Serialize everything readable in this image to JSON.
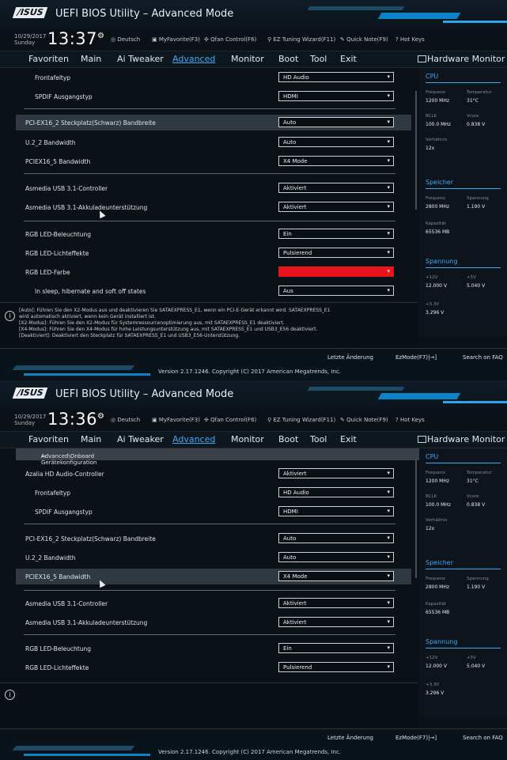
{
  "app_title": "UEFI BIOS Utility – Advanced Mode",
  "logo_text": "/ISUS",
  "accent_color": "#3fa9f5",
  "icons": [
    "logo",
    "info-icon",
    "hw-monitor-icon",
    "back-arrow-icon",
    "dropdown-arrow-icon",
    "cursor-icon"
  ],
  "menu": [
    "Favoriten",
    "Main",
    "Ai Tweaker",
    "Advanced",
    "Monitor",
    "Boot",
    "Tool",
    "Exit"
  ],
  "menu_active": "Advanced",
  "hw_monitor_title": "Hardware Monitor",
  "infobar": {
    "date": "10/29/2017",
    "day": "Sunday",
    "items": [
      "Deutsch",
      "MyFavorite(F3)",
      "Qfan Control(F6)",
      "EZ Tuning Wizard(F11)",
      "Quick Note(F9)",
      "Hot Keys"
    ]
  },
  "bottom": {
    "last_change": "Letzte Änderung",
    "ezmode": "EzMode(F7)|→]",
    "search": "Search on FAQ",
    "copyright": "Version 2.17.1246. Copyright (C) 2017 American Megatrends, Inc."
  },
  "hw": {
    "cpu_title": "CPU",
    "freq_label": "Frequenz",
    "freq_value": "1200 MHz",
    "temp_label": "Temperatur",
    "temp_value": "31°C",
    "bclk_label": "BCLK",
    "bclk_value": "100.0 MHz",
    "core_label": "Vcore",
    "core_value": "0.838 V",
    "ratio_label": "Verhältnis",
    "ratio_value": "12x",
    "mem_title": "Speicher",
    "mfreq_label": "Frequenz",
    "mfreq_value": "2800 MHz",
    "volt_label": "Spannung",
    "volt_value": "1.190 V",
    "cap_label": "Kapazität",
    "cap_value": "65536 MB",
    "volt_title": "Spannung",
    "v12_label": "+12V",
    "v12_value": "12.000 V",
    "v5_label": "+5V",
    "v5_value": "5.040 V",
    "v33_label": "+3.3V",
    "v33_value": "3.296 V"
  },
  "panel1": {
    "time": "13:37",
    "rows": [
      {
        "label": "Frontafeltyp",
        "value": "HD Audio"
      },
      {
        "label": "SPDIF Ausgangstyp",
        "value": "HDMI"
      },
      {
        "label": "PCI-EX16_2 Steckplatz(Schwarz) Bandbreite",
        "value": "Auto"
      },
      {
        "label": "U.2_2 Bandwidth",
        "value": "Auto"
      },
      {
        "label": "PCIEX16_5 Bandwidth",
        "value": "X4 Mode"
      },
      {
        "label": "Asmedia USB 3.1-Controller",
        "value": "Aktiviert"
      },
      {
        "label": "Asmedia USB 3.1-Akkuladeunterstützung",
        "value": "Aktiviert"
      },
      {
        "label": "RGB LED-Beleuchtung",
        "value": "Ein"
      },
      {
        "label": "RGB LED-Lichteffekte",
        "value": "Pulsierend"
      },
      {
        "label": "RGB LED-Farbe",
        "value": ""
      },
      {
        "label": "In sleep, hibernate and soft off states",
        "value": "Aus"
      }
    ],
    "help": [
      "[Auto]: Führen Sie den X2-Modus aus und deaktivieren Sie SATAEXPRESS_E1, wenn ein PCI-E-Gerät erkannt wird. SATAEXPRESS_E1",
      "wird automatisch aktiviert, wenn kein Gerät installiert ist.",
      "[X2-Modus]: Führen Sie den X2-Modus für Systemressourcenoptimierung aus, mit SATAEXPRESS_E1 deaktiviert.",
      "[X4-Modus]: Führen Sie den X4-Modus für hohe Leistungsunterstützung aus, mit SATAEXPRESS_E1 und USB3_E56 deaktiviert.",
      "[Deaktiviert]: Deaktiviert den Steckplatz für SATAEXPRESS_E1 und USB3_E56-Unterstützung."
    ]
  },
  "panel2": {
    "time": "13:36",
    "breadcrumb": "Advanced\\Onboard Gerätekonfiguration",
    "rows": [
      {
        "label": "Azalia HD Audio-Controller",
        "value": "Aktiviert"
      },
      {
        "label": "Frontafeltyp",
        "value": "HD Audio"
      },
      {
        "label": "SPDIF Ausgangstyp",
        "value": "HDMI"
      },
      {
        "label": "PCI-EX16_2 Steckplatz(Schwarz) Bandbreite",
        "value": "Auto"
      },
      {
        "label": "U.2_2 Bandwidth",
        "value": "Auto"
      },
      {
        "label": "PCIEX16_5 Bandwidth",
        "value": "X4 Mode"
      },
      {
        "label": "Asmedia USB 3.1-Controller",
        "value": "Aktiviert"
      },
      {
        "label": "Asmedia USB 3.1-Akkuladeunterstützung",
        "value": "Aktiviert"
      },
      {
        "label": "RGB LED-Beleuchtung",
        "value": "Ein"
      },
      {
        "label": "RGB LED-Lichteffekte",
        "value": "Pulsierend"
      }
    ]
  }
}
